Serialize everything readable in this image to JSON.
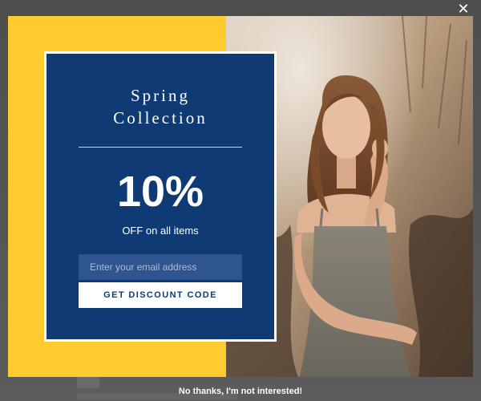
{
  "popup": {
    "close_label": "✕",
    "title": "Spring\nCollection",
    "discount_value": "10%",
    "discount_caption": "OFF on all items",
    "email_placeholder": "Enter your email address",
    "email_value": "",
    "cta_label": "GET DISCOUNT CODE",
    "dismiss_label": "No thanks, I'm not interested!",
    "photo_icon": "model-photo"
  },
  "colors": {
    "accent_yellow": "#ffcb2f",
    "card_blue": "#0f3a74",
    "field_blue": "#2f5590",
    "overlay_gray": "#5a5a5a"
  }
}
